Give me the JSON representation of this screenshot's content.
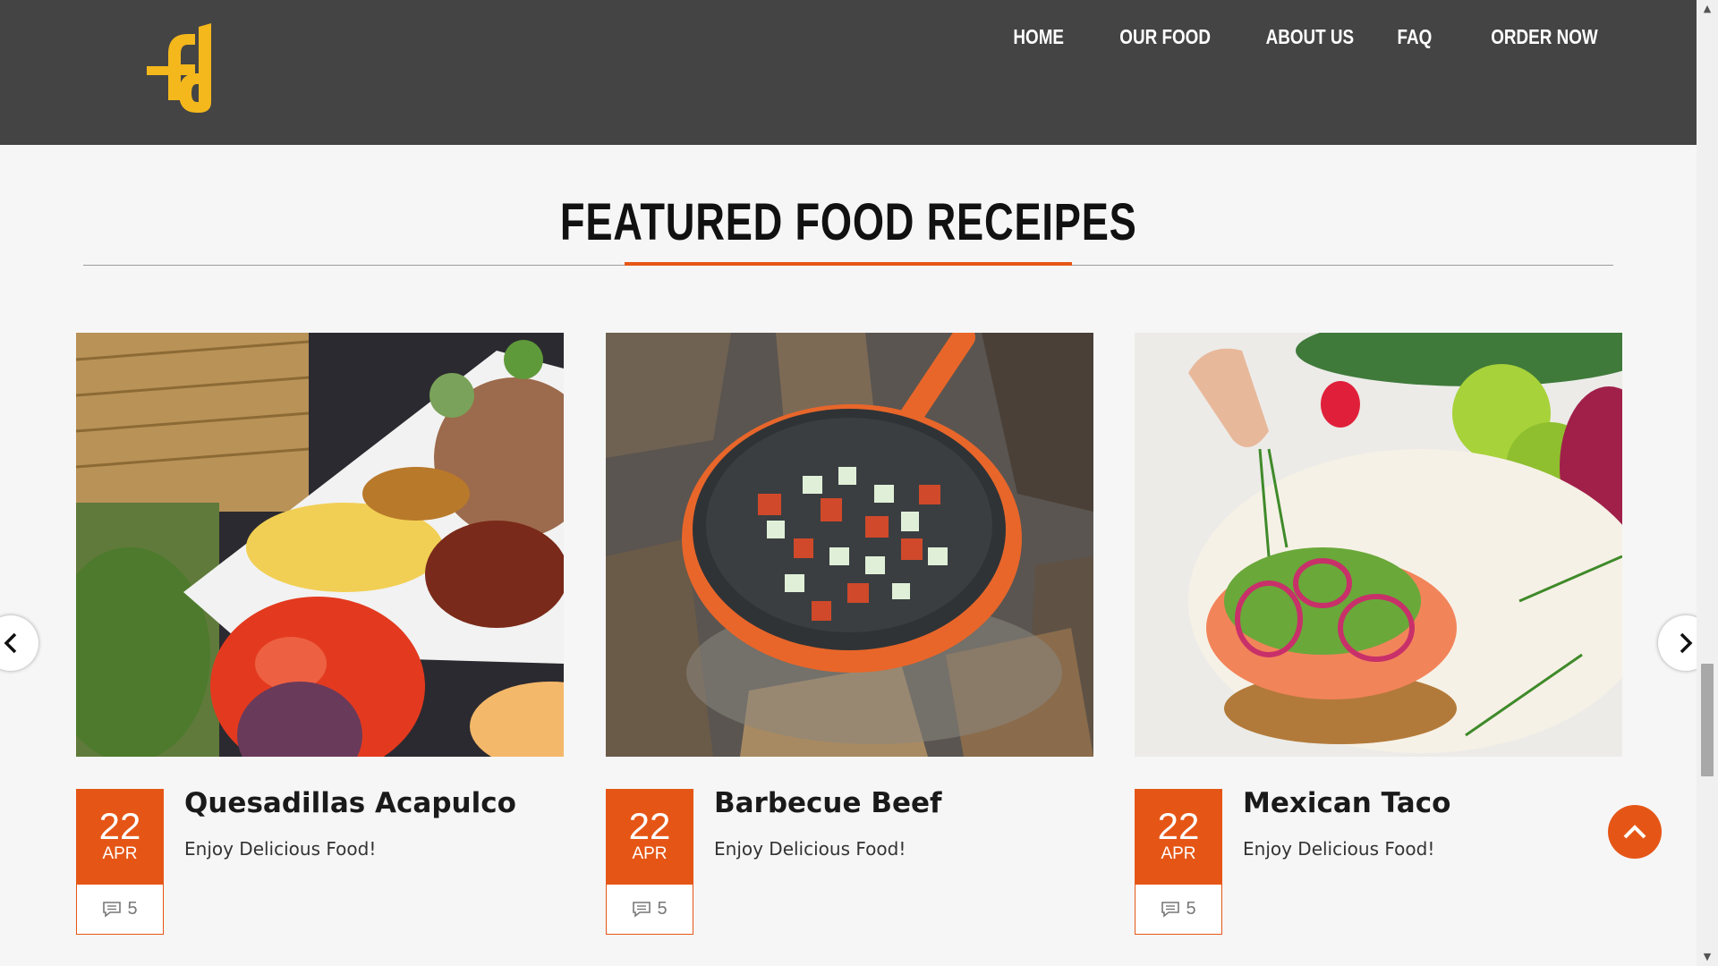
{
  "brand": {
    "logo_text": "fd",
    "logo_color": "#f4b81c"
  },
  "nav": {
    "items": [
      {
        "label": "HOME"
      },
      {
        "label": "OUR FOOD"
      },
      {
        "label": "ABOUT US"
      },
      {
        "label": "FAQ"
      },
      {
        "label": "ORDER NOW"
      }
    ]
  },
  "section": {
    "title": "FEATURED FOOD RECEIPES",
    "accent_color": "#e55616"
  },
  "cards": [
    {
      "title": "Quesadillas Acapulco",
      "subtitle": "Enjoy Delicious Food!",
      "day": "22",
      "month": "APR",
      "comments": "5",
      "image": "rice-plate-with-tomato-photo"
    },
    {
      "title": "Barbecue Beef",
      "subtitle": "Enjoy Delicious Food!",
      "day": "22",
      "month": "APR",
      "comments": "5",
      "image": "skillet-over-campfire-photo"
    },
    {
      "title": "Mexican Taco",
      "subtitle": "Enjoy Delicious Food!",
      "day": "22",
      "month": "APR",
      "comments": "5",
      "image": "salmon-tostada-photo"
    }
  ],
  "icons": {
    "prev": "chevron-left-icon",
    "next": "chevron-right-icon",
    "back_to_top": "chevron-up-icon",
    "comments": "comment-icon"
  }
}
